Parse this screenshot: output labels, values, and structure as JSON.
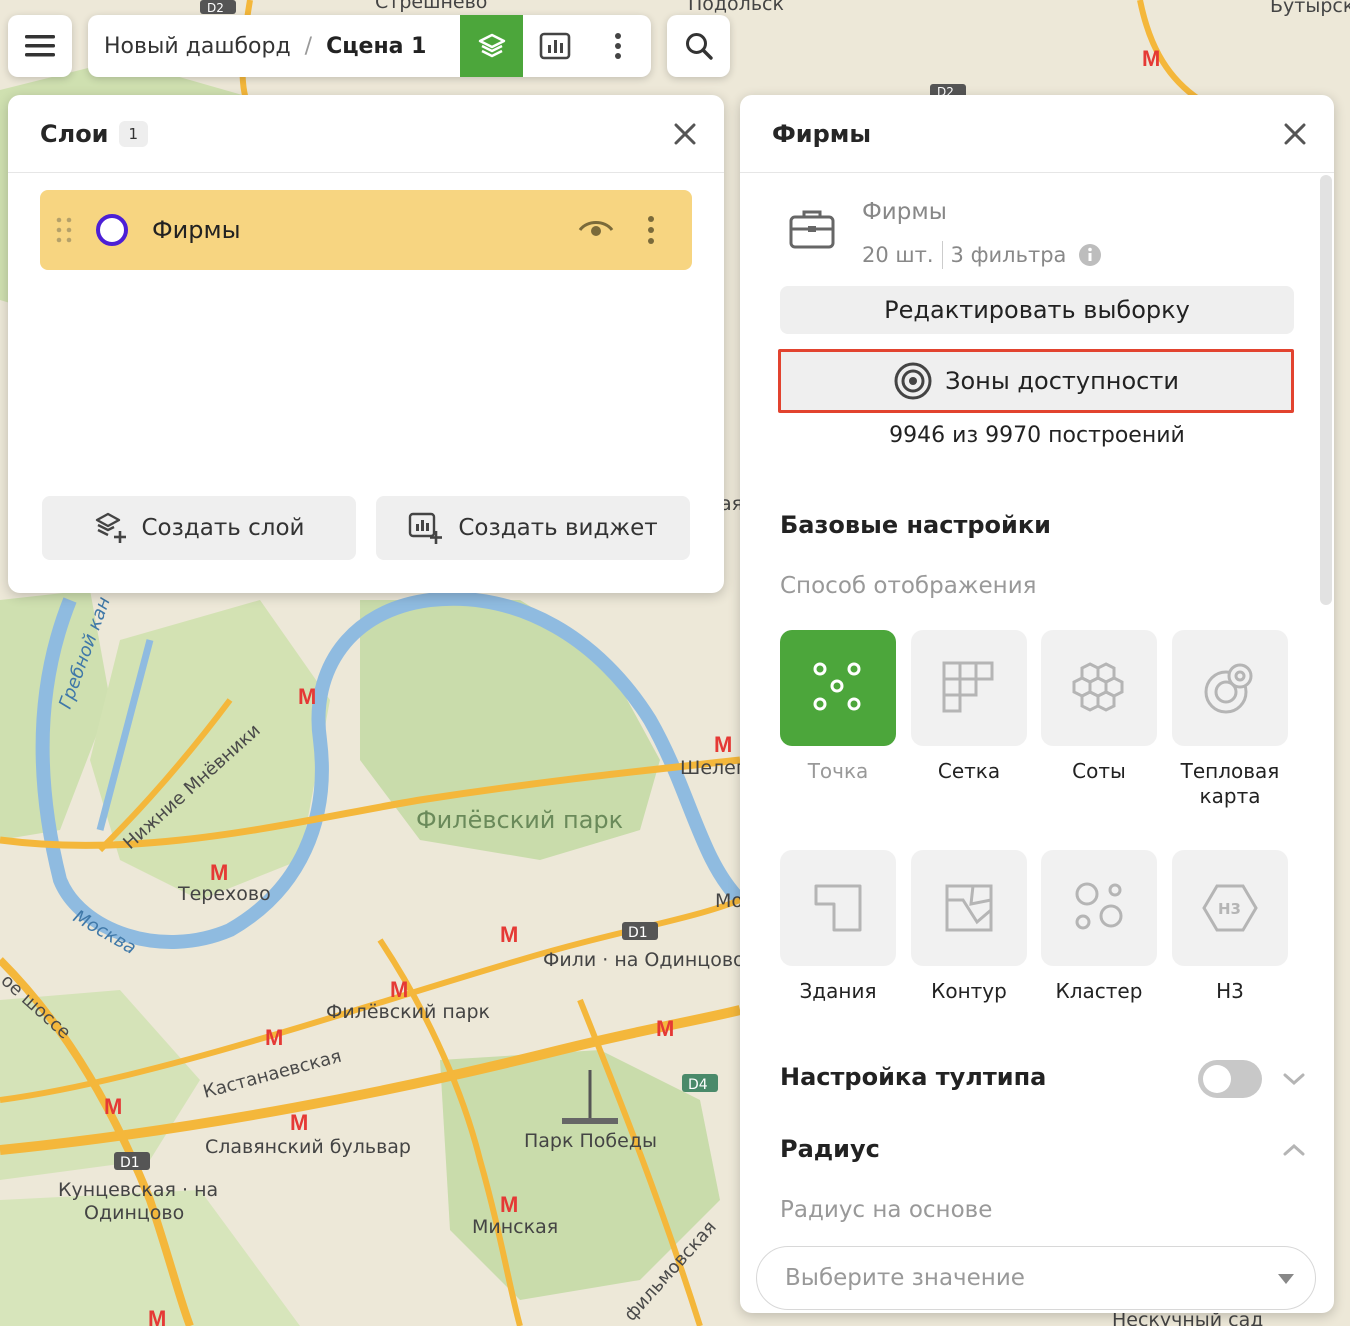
{
  "toolbar": {
    "breadcrumb_dashboard": "Новый дашборд",
    "breadcrumb_separator": "/",
    "breadcrumb_scene": "Сцена 1",
    "accent_color": "#4ca63b"
  },
  "map": {
    "labels": {
      "streshnevo": "Стрешнево",
      "podolsk": "Подольск",
      "butyrskaya": "Бутырска",
      "grebnoy": "Гребной кан",
      "nizhnie": "Нижние Мнёвники",
      "terekhovo": "Терехово",
      "moskva": "Москва",
      "filevsky_park_area": "Филёвский парк",
      "filevsky_park_station": "Филёвский парк",
      "sheleп": "Шелеп",
      "fili": "Фили · на Одинцово",
      "kastanaevskaya": "Кастанаевская",
      "slavyansky": "Славянский бульвар",
      "kuntsevskaya_1": "Кунцевская · на",
      "kuntsevskaya_2": "Одинцово",
      "park_pobedy": "Парк Победы",
      "minskaya": "Минская",
      "filmovskaya": "фильмовская",
      "shosse": "ое шоссе",
      "neskuchny": "Нескучный сад",
      "d1_a": "D1",
      "d1_b": "D1",
      "d2_a": "D2",
      "d2_b": "D2",
      "d4": "D4",
      "mo": "Мо",
      "aya": "ая",
      "metro_glyph": "М"
    }
  },
  "layers_panel": {
    "title": "Слои",
    "count": "1",
    "layer": {
      "name": "Фирмы",
      "highlight_color": "#f7d581",
      "circle_color": "#4c1fd6"
    },
    "create_layer_label": "Создать слой",
    "create_widget_label": "Создать виджет"
  },
  "firms_panel": {
    "title": "Фирмы",
    "source_title": "Фирмы",
    "source_count": "20 шт.",
    "source_filters": "3 фильтра",
    "edit_selection_label": "Редактировать выборку",
    "access_zones_label": "Зоны доступности",
    "highlight_color": "#e2432f",
    "builds_count": "9946 из 9970 построений",
    "basic_settings_title": "Базовые настройки",
    "display_mode_label": "Способ отображения",
    "modes": [
      {
        "label": "Точка",
        "icon": "dots-icon",
        "active": true
      },
      {
        "label": "Сетка",
        "icon": "grid-icon",
        "active": false
      },
      {
        "label": "Соты",
        "icon": "hexagons-icon",
        "active": false
      },
      {
        "label": "Тепловая карта",
        "icon": "heatmap-icon",
        "active": false
      },
      {
        "label": "Здания",
        "icon": "building-icon",
        "active": false
      },
      {
        "label": "Контур",
        "icon": "contour-icon",
        "active": false
      },
      {
        "label": "Кластер",
        "icon": "cluster-icon",
        "active": false
      },
      {
        "label": "Н3",
        "icon": "h3-icon",
        "active": false
      }
    ],
    "tooltip_settings_title": "Настройка тултипа",
    "tooltip_enabled": false,
    "radius_title": "Радиус",
    "radius_based_label": "Радиус на основе",
    "radius_select_placeholder": "Выберите значение"
  }
}
